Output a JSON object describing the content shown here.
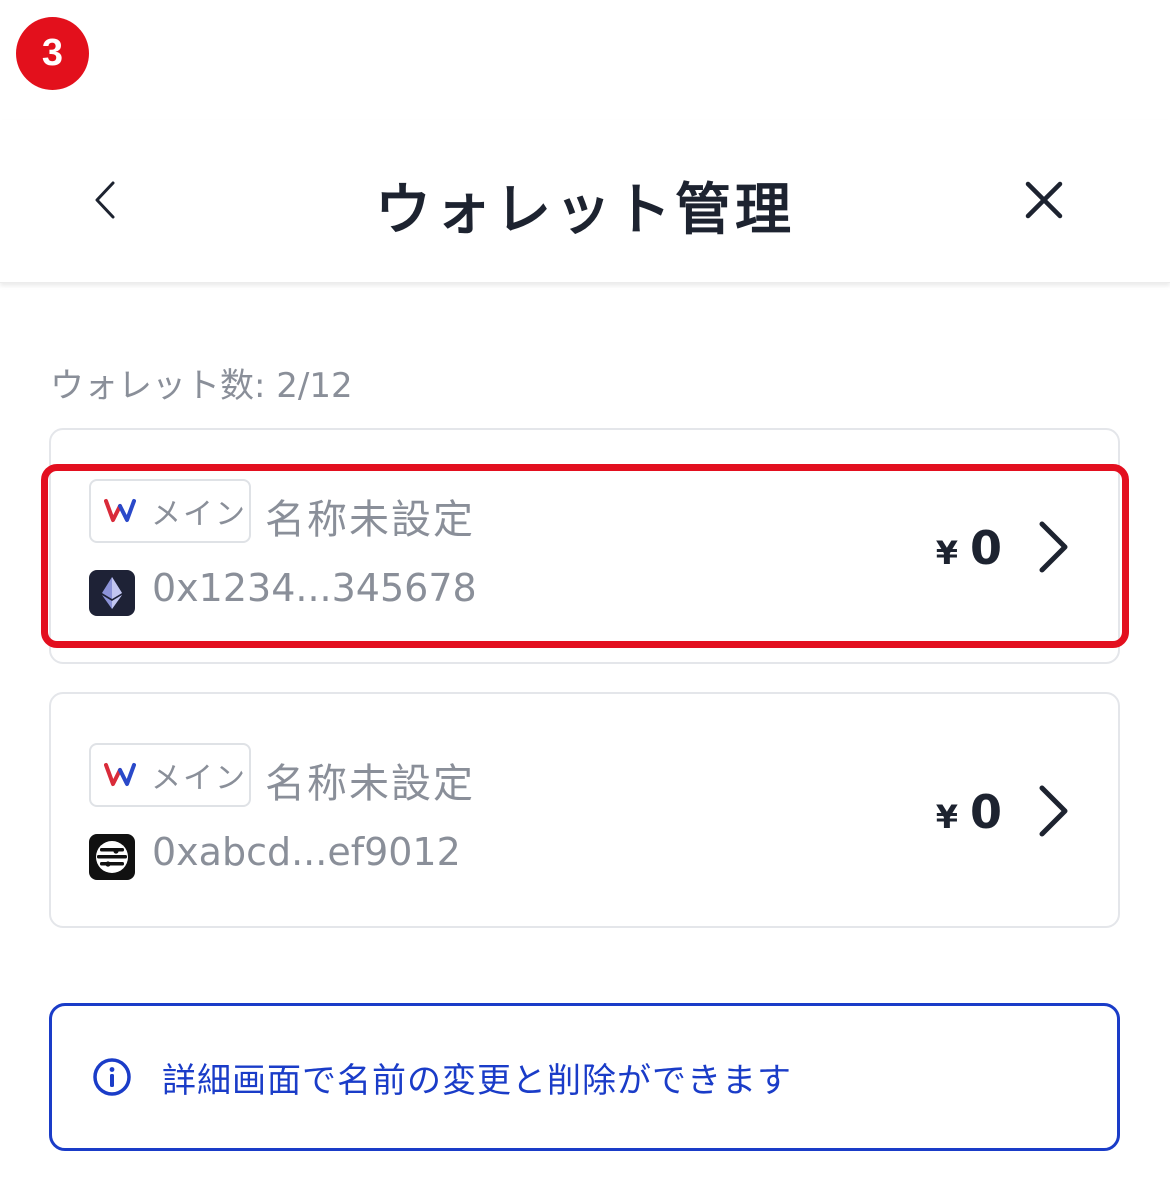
{
  "step_badge": "3",
  "header": {
    "title": "ウォレット管理",
    "back_icon": "chevron-left-icon",
    "close_icon": "close-icon"
  },
  "wallet_count": "ウォレット数: 2/12",
  "wallets": [
    {
      "tag_label": "メイン",
      "name": "名称未設定",
      "address": "0x1234...345678",
      "chain_icon": "ethereum-icon",
      "currency": "¥",
      "balance": "0",
      "highlighted": true
    },
    {
      "tag_label": "メイン",
      "name": "名称未設定",
      "address": "0xabcd...ef9012",
      "chain_icon": "network-icon",
      "currency": "¥",
      "balance": "0",
      "highlighted": false
    }
  ],
  "info": {
    "icon": "info-icon",
    "text": "詳細画面で名前の変更と削除ができます"
  },
  "colors": {
    "highlight": "#e30f1f",
    "badge": "#e3101c",
    "info_blue": "#1a3cc8",
    "muted_text": "#8a8f99",
    "dark_text": "#1d2330"
  }
}
